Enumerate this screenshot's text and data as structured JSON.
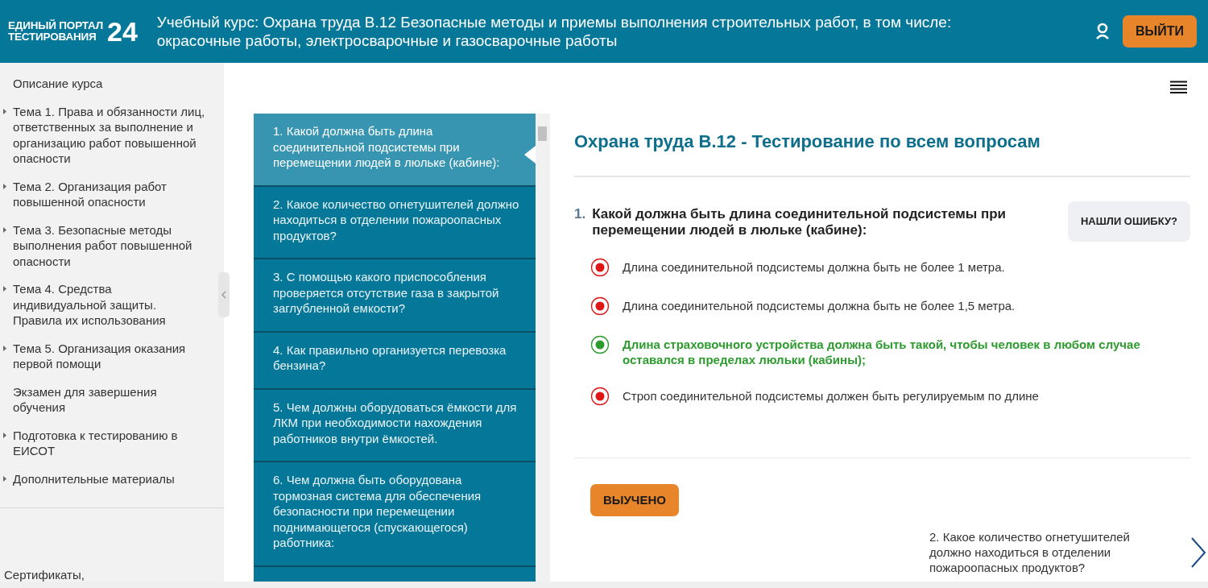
{
  "header": {
    "logo_text": [
      "ЕДИНЫЙ ПОРТАЛ",
      "ТЕСТИРОВАНИЯ"
    ],
    "logo_number": "24",
    "course_title": "Учебный курс: Охрана труда В.12 Безопасные методы и приемы выполнения строительных работ, в том числе: окрасочные работы, электросварочные и газосварочные работы",
    "logout_button": "ВЫЙТИ"
  },
  "sidebar": {
    "items": [
      {
        "label": "Описание курса",
        "expandable": false
      },
      {
        "label": "Тема 1. Права и обязанности лиц, ответственных за выполнение и организацию работ повышенной опасности",
        "expandable": true
      },
      {
        "label": "Тема 2. Организация работ повышенной опасности",
        "expandable": true
      },
      {
        "label": "Тема 3. Безопасные методы выполнения работ повышенной опасности",
        "expandable": true
      },
      {
        "label": "Тема 4. Средства индивидуальной защиты. Правила их использования",
        "expandable": true
      },
      {
        "label": "Тема 5. Организация оказания первой помощи",
        "expandable": true
      },
      {
        "label": "Экзамен для завершения обучения",
        "expandable": false
      },
      {
        "label": "Подготовка к тестированию в ЕИСОТ",
        "expandable": true
      },
      {
        "label": "Дополнительные материалы",
        "expandable": true
      }
    ],
    "footer_text": "Сертификаты,"
  },
  "question_list": [
    {
      "label": "1. Какой должна быть длина соединительной подсистемы при перемещении людей в люльке (кабине):",
      "selected": true
    },
    {
      "label": "2. Какое количество огнетушителей должно находиться в отделении пожароопасных продуктов?",
      "selected": false
    },
    {
      "label": "3. С помощью какого приспособления проверяется отсутствие газа в закрытой заглубленной емкости?",
      "selected": false
    },
    {
      "label": "4. Как правильно организуется перевозка бензина?",
      "selected": false
    },
    {
      "label": "5. Чем должны оборудоваться ёмкости для ЛКМ при необходимости нахождения работников внутри ёмкостей.",
      "selected": false
    },
    {
      "label": "6. Чем должна быть оборудована тормозная система для обеспечения безопасности при перемещении поднимающегося (спускающегося) работника:",
      "selected": false
    }
  ],
  "test": {
    "title": "Охрана труда В.12 - Тестирование по всем вопросам",
    "question_number": "1.",
    "question_text": "Какой должна быть длина соединительной подсистемы при перемещении людей в люльке (кабине):",
    "report_button": "НАШЛИ ОШИБКУ?",
    "answers": [
      {
        "text": "Длина соединительной подсистемы должна быть не более 1 метра.",
        "correct": false
      },
      {
        "text": "Длина соединительной подсистемы должна быть не более 1,5 метра.",
        "correct": false
      },
      {
        "text": "Длина страховочного устройства должна быть такой, чтобы человек в любом случае оставался в пределах люльки (кабины);",
        "correct": true
      },
      {
        "text": "Строп соединительной подсистемы должен быть регулируемым по длине",
        "correct": false
      }
    ],
    "learned_button": "ВЫУЧЕНО",
    "next_question": "2. Какое количество огнетушителей должно находиться в отделении пожароопасных продуктов?"
  }
}
